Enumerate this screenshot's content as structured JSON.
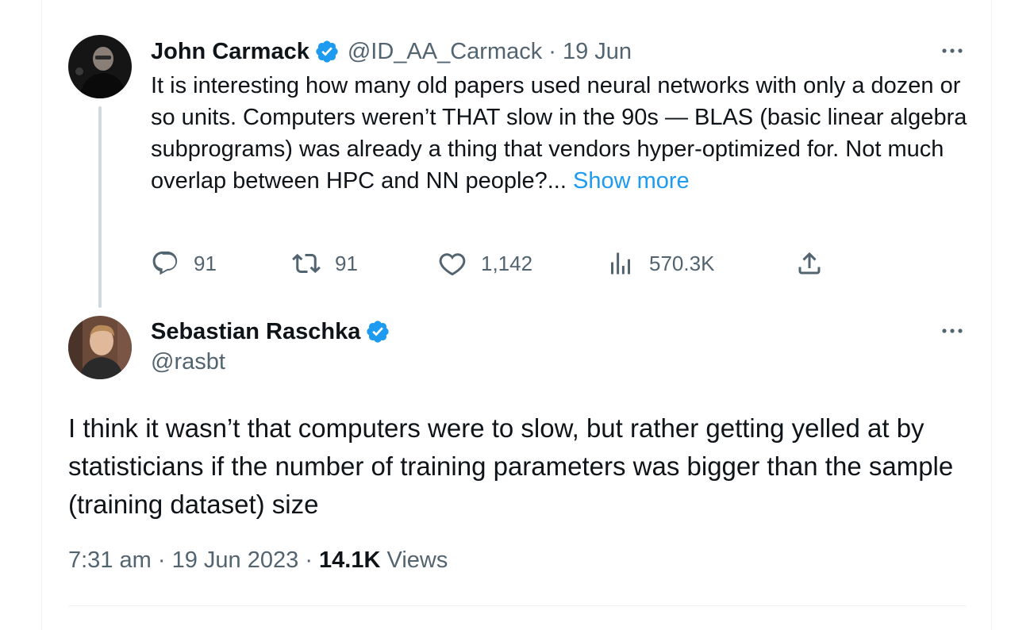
{
  "original_tweet": {
    "author_name": "John Carmack",
    "handle": "@ID_AA_Carmack",
    "separator": "·",
    "date": "19 Jun",
    "text": "It is interesting how many old papers used neural networks with only a dozen or so units. Computers weren’t THAT slow in the 90s — BLAS (basic linear algebra subprograms) was already a thing that vendors hyper-optimized for. Not much overlap between HPC and NN people?...",
    "show_more": "Show more",
    "stats": {
      "replies": "91",
      "retweets": "91",
      "likes": "1,142",
      "views": "570.3K"
    }
  },
  "reply_tweet": {
    "author_name": "Sebastian Raschka",
    "handle": "@rasbt",
    "text": "I think it wasn’t that computers were to slow, but rather getting yelled at by statisticians if the number of training parameters was bigger than the sample (training dataset) size",
    "time": "7:31 am",
    "separator": "·",
    "date": "19 Jun 2023",
    "views_count": "14.1K",
    "views_label": "Views"
  },
  "icons": {
    "verified": "verified-badge-icon",
    "more": "more-options-icon",
    "reply": "reply-icon",
    "retweet": "retweet-icon",
    "like": "heart-icon",
    "views": "views-chart-icon",
    "share": "share-icon"
  },
  "colors": {
    "accent": "#1d9bf0",
    "text_primary": "#0f1419",
    "text_secondary": "#536471",
    "thread_line": "#cfd9de"
  }
}
